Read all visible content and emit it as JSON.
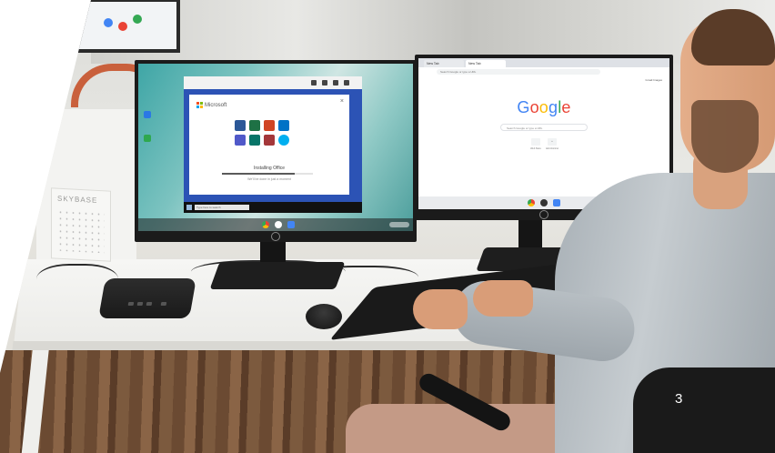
{
  "colors": {
    "wallpaper": "#4fa9a6",
    "windows_frame": "#2c53b5",
    "google_blue": "#4285F4",
    "google_red": "#EA4335",
    "google_yellow": "#FBBC05",
    "google_green": "#34A853",
    "page_number": "#ffffff"
  },
  "background_calendar": {
    "title": "SKYBASE"
  },
  "left_monitor": {
    "ms_brand": "Microsoft",
    "install_title": "Installing Office",
    "install_subtitle": "We'll be done in just a moment",
    "install_progress": 0.8,
    "taskbar_search_placeholder": "Type here to search",
    "icons": [
      "word-icon",
      "excel-icon",
      "powerpoint-icon",
      "outlook-icon",
      "teams-icon",
      "publisher-icon",
      "access-icon",
      "skype-icon"
    ]
  },
  "right_monitor": {
    "tab_1": "New Tab",
    "tab_2": "New Tab",
    "omnibox_placeholder": "Search Google or type a URL",
    "top_links": "Gmail  Images",
    "logo_letters": [
      "G",
      "o",
      "o",
      "g",
      "l",
      "e"
    ],
    "search_placeholder": "Search Google or type a URL",
    "shortcut_1_label": "Web Store",
    "shortcut_2_label": "Add shortcut"
  },
  "page_number": "3"
}
